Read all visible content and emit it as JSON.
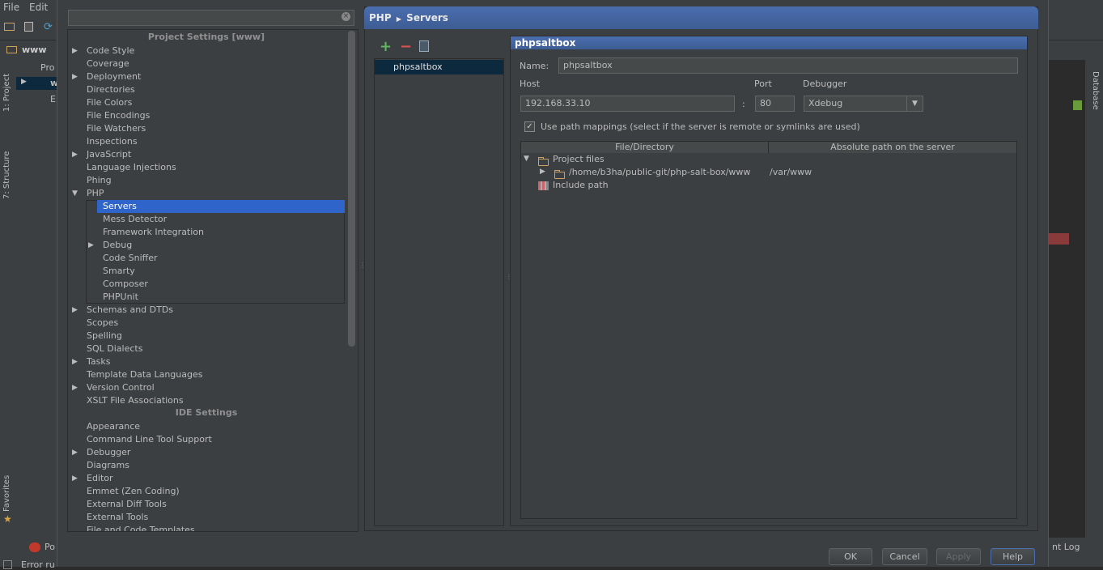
{
  "ide": {
    "menu": [
      "File",
      "Edit"
    ],
    "nav_project": "www",
    "left_tabs": [
      "1: Project",
      "7: Structure",
      "Favorites"
    ],
    "right_tabs": [
      "Database"
    ],
    "status_left": "Po",
    "status_right": "nt Log",
    "status_bottom": "Error ru",
    "partial_tree": [
      "Pro",
      "w",
      "E"
    ]
  },
  "dialog": {
    "search_value": "",
    "sections": {
      "project": "Project Settings [www]",
      "ide": "IDE Settings"
    },
    "project_items": [
      {
        "label": "Code Style",
        "expandable": true
      },
      {
        "label": "Coverage",
        "expandable": false
      },
      {
        "label": "Deployment",
        "expandable": true
      },
      {
        "label": "Directories",
        "expandable": false
      },
      {
        "label": "File Colors",
        "expandable": false
      },
      {
        "label": "File Encodings",
        "expandable": false
      },
      {
        "label": "File Watchers",
        "expandable": false
      },
      {
        "label": "Inspections",
        "expandable": false
      },
      {
        "label": "JavaScript",
        "expandable": true
      },
      {
        "label": "Language Injections",
        "expandable": false
      },
      {
        "label": "Phing",
        "expandable": false
      },
      {
        "label": "PHP",
        "expandable": true,
        "expanded": true
      }
    ],
    "php_children": [
      {
        "label": "Servers",
        "selected": true
      },
      {
        "label": "Mess Detector"
      },
      {
        "label": "Framework Integration"
      },
      {
        "label": "Debug",
        "expandable": true
      },
      {
        "label": "Code Sniffer"
      },
      {
        "label": "Smarty"
      },
      {
        "label": "Composer"
      },
      {
        "label": "PHPUnit"
      }
    ],
    "project_items_after": [
      {
        "label": "Schemas and DTDs",
        "expandable": true
      },
      {
        "label": "Scopes",
        "expandable": false
      },
      {
        "label": "Spelling",
        "expandable": false
      },
      {
        "label": "SQL Dialects",
        "expandable": false
      },
      {
        "label": "Tasks",
        "expandable": true
      },
      {
        "label": "Template Data Languages",
        "expandable": false
      },
      {
        "label": "Version Control",
        "expandable": true
      },
      {
        "label": "XSLT File Associations",
        "expandable": false
      }
    ],
    "ide_items": [
      {
        "label": "Appearance",
        "expandable": false
      },
      {
        "label": "Command Line Tool Support",
        "expandable": false
      },
      {
        "label": "Debugger",
        "expandable": true
      },
      {
        "label": "Diagrams",
        "expandable": false
      },
      {
        "label": "Editor",
        "expandable": true
      },
      {
        "label": "Emmet (Zen Coding)",
        "expandable": false
      },
      {
        "label": "External Diff Tools",
        "expandable": false
      },
      {
        "label": "External Tools",
        "expandable": false
      },
      {
        "label": "File and Code Templates",
        "expandable": false
      }
    ],
    "breadcrumb": {
      "parent": "PHP",
      "current": "Servers"
    },
    "servers": [
      "phpsaltbox"
    ],
    "detail": {
      "title": "phpsaltbox",
      "name_label": "Name:",
      "name_value": "phpsaltbox",
      "host_label": "Host",
      "host_value": "192.168.33.10",
      "port_label": "Port",
      "port_value": "80",
      "debugger_label": "Debugger",
      "debugger_value": "Xdebug",
      "path_mappings_label": "Use path mappings (select if the server is remote or symlinks are used)",
      "path_mappings_checked": true,
      "columns": [
        "File/Directory",
        "Absolute path on the server"
      ],
      "project_files_label": "Project files",
      "mapping": {
        "local": "/home/b3ha/public-git/php-salt-box/www",
        "remote": "/var/www"
      },
      "include_path_label": "Include path"
    },
    "buttons": {
      "ok": "OK",
      "cancel": "Cancel",
      "apply": "Apply",
      "help": "Help"
    }
  }
}
